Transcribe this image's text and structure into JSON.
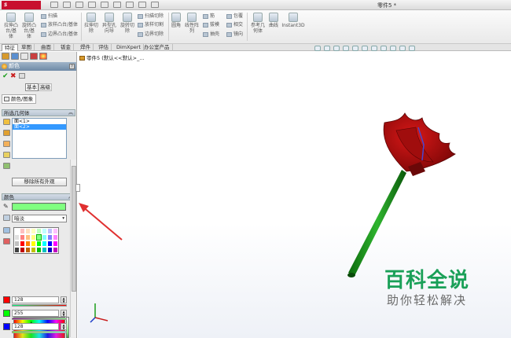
{
  "titlebar": {
    "logo_text": "S SOLIDWORKS",
    "document_title": "零件5 *"
  },
  "ribbon": {
    "extrude_boss": "拉伸凸\n台/基\n体",
    "revolve_boss": "旋转凸\n台/基\n体",
    "sweep": "扫描",
    "loft_boss": "放样凸台/基体",
    "boundary_boss": "边界凸台/基体",
    "extrude_cut": "拉伸切\n除",
    "hole_wizard": "异型孔\n向导",
    "revolve_cut": "旋转切\n除",
    "sweep_cut": "扫描切除",
    "loft_cut": "放样切割",
    "boundary_cut": "边界切除",
    "fillet": "圆角",
    "linear_pattern": "线性阵\n列",
    "rib": "筋",
    "draft": "拔模",
    "shell": "抽壳",
    "wrap": "包覆",
    "intersect": "相交",
    "mirror": "镜向",
    "ref_geometry": "参考几\n何体",
    "curves": "曲线",
    "instant3d": "Instant3D"
  },
  "tabs": [
    "特征",
    "草图",
    "曲面",
    "钣金",
    "焊件",
    "评估",
    "DimXpert",
    "办公室产品"
  ],
  "feature_tree": {
    "root_label": "零件5 (默认<<默认>_..."
  },
  "property_manager": {
    "title": "颜色",
    "help": "?",
    "ok": "✔",
    "cancel": "✖",
    "basic_label": "基本",
    "advanced_label": "高级",
    "subtab_label": "颜色/图象",
    "selected_group_title": "所选几何体",
    "selected_items": [
      "面<1>",
      "面<2>"
    ],
    "remove_appearance_label": "移除所有外观",
    "color_group_title": "颜色",
    "current_color": "#80ff80",
    "finish_option": "暗淡",
    "channels": [
      {
        "color": "#ff0000",
        "value": "128"
      },
      {
        "color": "#00ff00",
        "value": "255"
      },
      {
        "color": "#0000ff",
        "value": "128"
      }
    ],
    "collapse_chevron": "︽",
    "dropdown_arrow": "▾",
    "crosshair": "✛",
    "eyedropper": "✎",
    "spin_up": "▲",
    "spin_down": "▼"
  },
  "palette_colors": [
    "#ffffff",
    "#ffc0c0",
    "#ffe0c0",
    "#ffffc0",
    "#c0ffc0",
    "#c0ffff",
    "#c0c0ff",
    "#ffc0ff",
    "#e0e0e0",
    "#ff8080",
    "#ffc080",
    "#ffff80",
    "#80ff80",
    "#80ffff",
    "#8080ff",
    "#ff80ff",
    "#c0c0c0",
    "#ff0000",
    "#ff8000",
    "#ffff00",
    "#00ff00",
    "#00ffff",
    "#0000ff",
    "#ff00ff",
    "#404040",
    "#c00000",
    "#c06000",
    "#c0c000",
    "#00c000",
    "#00c0c0",
    "#0000c0",
    "#c000c0"
  ],
  "watermark": {
    "title": "百科全说",
    "subtitle": "助你轻松解决"
  }
}
